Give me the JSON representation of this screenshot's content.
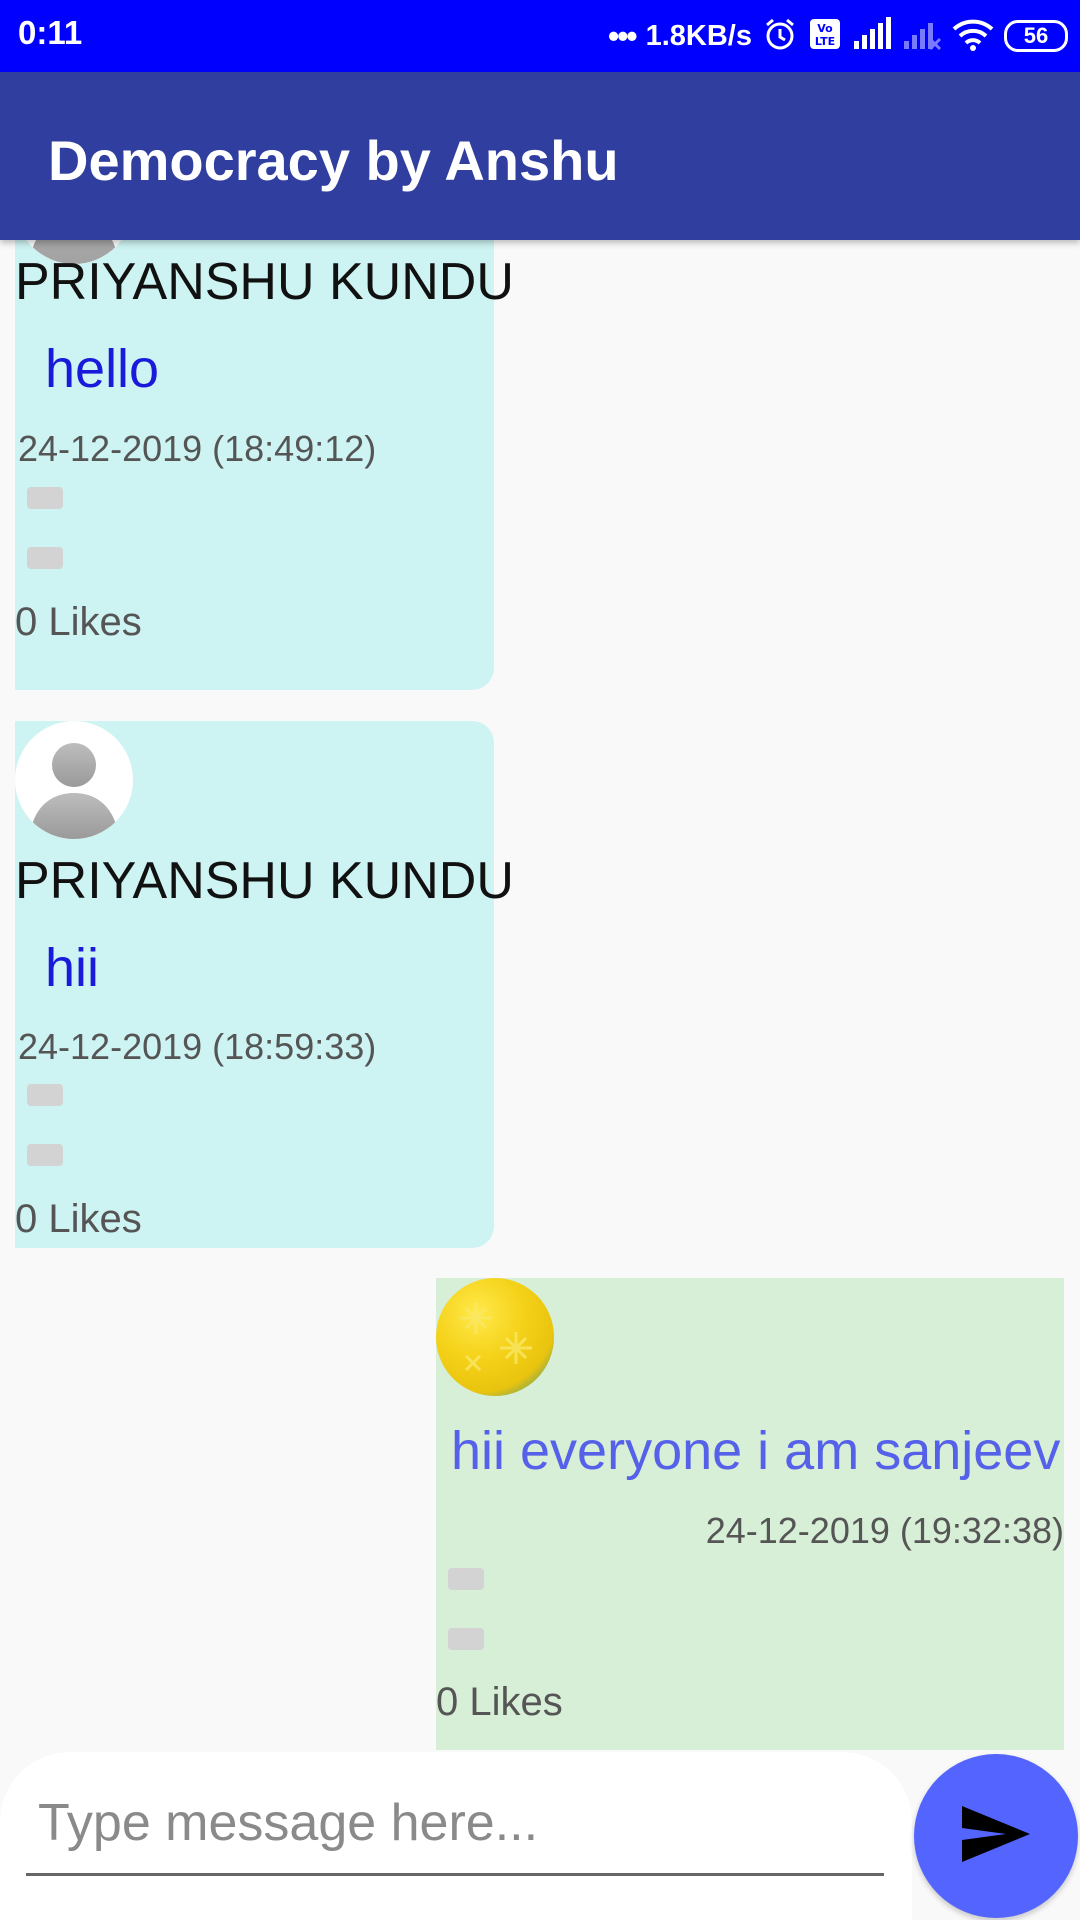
{
  "status_bar": {
    "time": "0:11",
    "dots": "•••",
    "net_speed": "1.8KB/s",
    "battery": "56",
    "icons": [
      "alarm-icon",
      "volte-icon",
      "signal-icon",
      "signal-no-sim-icon",
      "wifi-icon",
      "battery-icon"
    ]
  },
  "app": {
    "title": "Democracy by Anshu",
    "accent": "#303f9f",
    "status_color": "#0000ff"
  },
  "messages": [
    {
      "direction": "incoming",
      "sender": "PRIYANSHU KUNDU",
      "text": "hello",
      "timestamp": "24-12-2019 (18:49:12)",
      "likes": "0 Likes",
      "avatar": "default-avatar-icon"
    },
    {
      "direction": "incoming",
      "sender": "PRIYANSHU KUNDU",
      "text": "hii",
      "timestamp": "24-12-2019 (18:59:33)",
      "likes": "0 Likes",
      "avatar": "default-avatar-icon"
    },
    {
      "direction": "outgoing",
      "sender": "",
      "text": "hii everyone i am sanjeev",
      "timestamp": "24-12-2019 (19:32:38)",
      "likes": "0 Likes",
      "avatar": "flower-avatar-icon"
    }
  ],
  "composer": {
    "placeholder": "Type message here...",
    "value": "",
    "send_icon": "send-icon",
    "send_color": "#5364ff"
  }
}
